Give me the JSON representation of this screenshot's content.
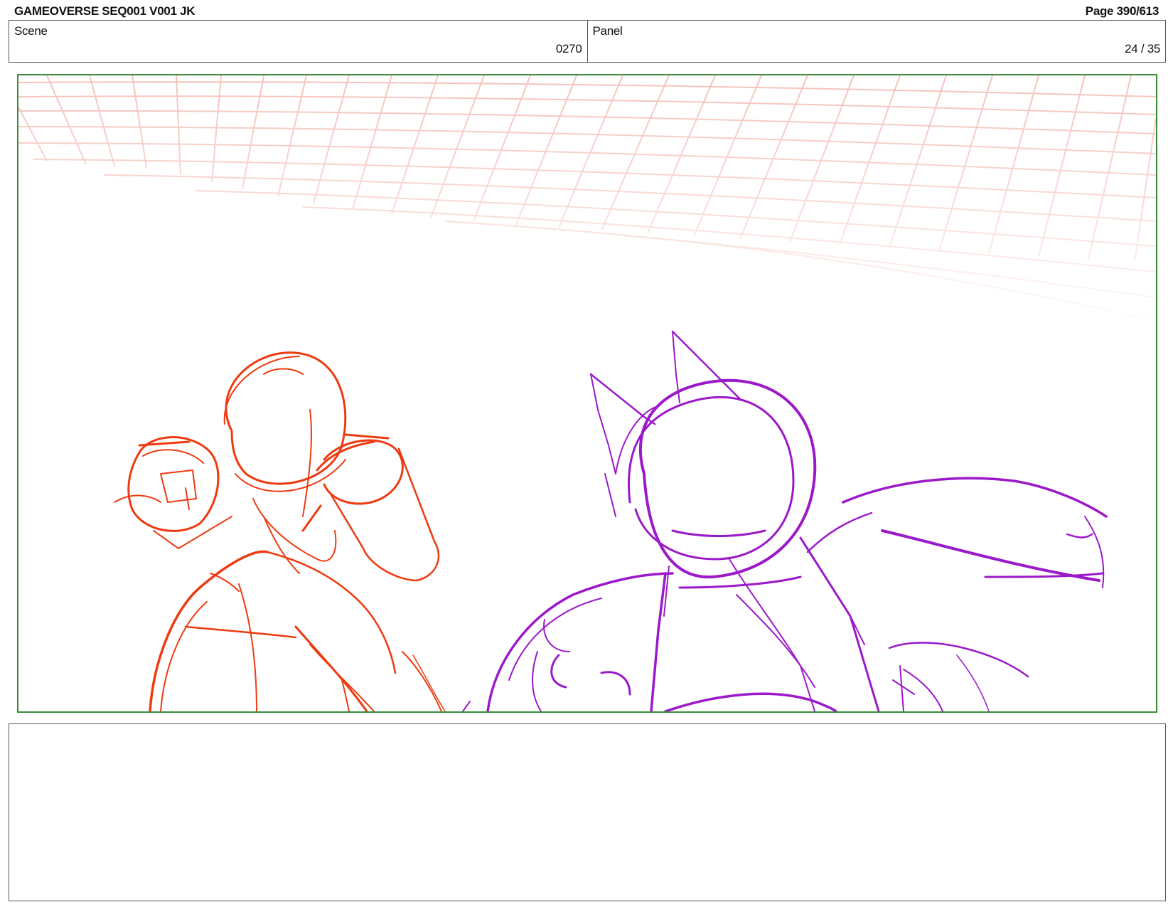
{
  "header": {
    "title": "GAMEOVERSE SEQ001 V001 JK",
    "page": "Page 390/613"
  },
  "info": {
    "scene_label": "Scene",
    "scene_value": "0270",
    "panel_label": "Panel",
    "panel_value": "24 / 35"
  },
  "colors": {
    "frame": "#3a8c3a",
    "grid": "#f4b8b0",
    "character_left": "#ee3a10",
    "character_right": "#9b19c9"
  }
}
